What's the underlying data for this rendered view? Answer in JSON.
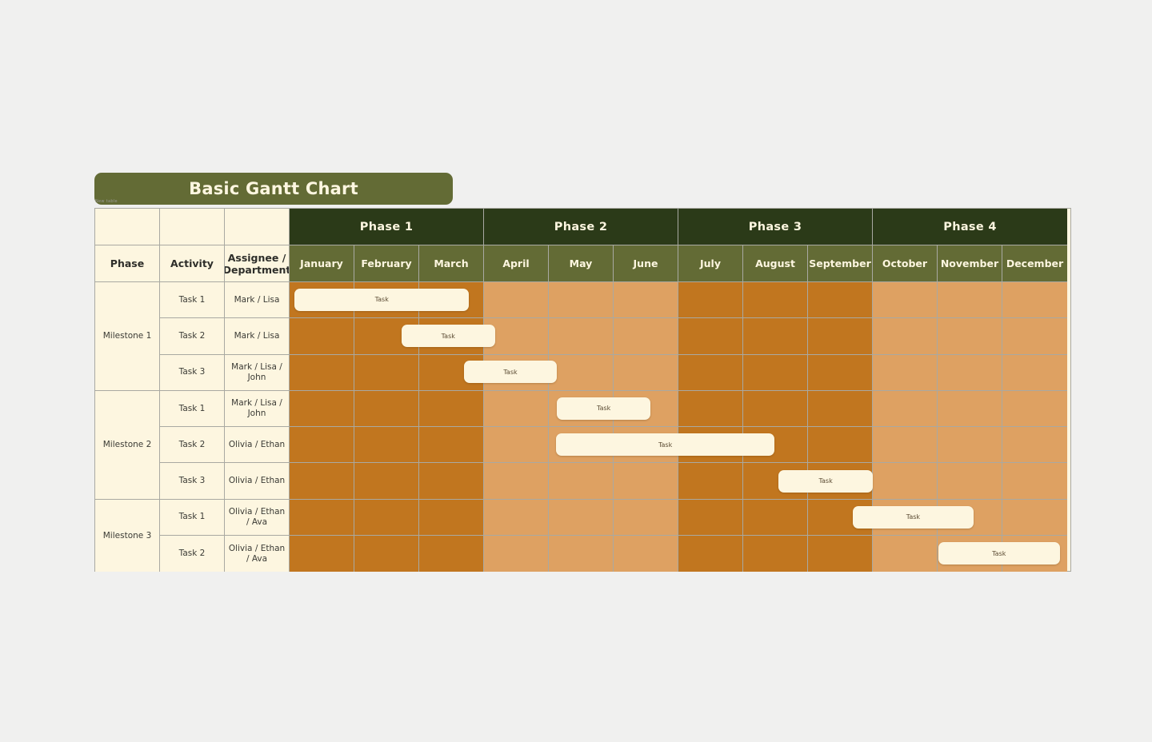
{
  "title": {
    "text": "Basic Gantt Chart"
  },
  "ghost_label": "New table",
  "colors": {
    "page_background": "#f0f0ef",
    "banner": "#636b35",
    "phase_header": "#2b3a18",
    "month_header": "#636b35",
    "cream": "#fdf6e0",
    "timeline_dark": "#c1761f",
    "timeline_light": "#dea162",
    "grid_line": "#a9a9a2"
  },
  "table": {
    "left_headers": [
      "Phase",
      "Activity",
      "Assignee / Department"
    ],
    "left_headers_display": {
      "phase": "Phase",
      "activity": "Activity",
      "assignee_line1": "Assignee /",
      "assignee_line2": "Department"
    },
    "phases": [
      {
        "label": "Phase 1",
        "months": [
          "January",
          "February",
          "March"
        ],
        "shade": "dark"
      },
      {
        "label": "Phase 2",
        "months": [
          "April",
          "May",
          "June"
        ],
        "shade": "light"
      },
      {
        "label": "Phase 3",
        "months": [
          "July",
          "August",
          "September"
        ],
        "shade": "dark"
      },
      {
        "label": "Phase 4",
        "months": [
          "October",
          "November",
          "December"
        ],
        "shade": "light"
      }
    ],
    "months": [
      "January",
      "February",
      "March",
      "April",
      "May",
      "June",
      "July",
      "August",
      "September",
      "October",
      "November",
      "December"
    ],
    "milestones": [
      {
        "label": "Milestone 1",
        "rows": [
          {
            "activity": "Task 1",
            "assignee": "Mark / Lisa"
          },
          {
            "activity": "Task 2",
            "assignee": "Mark / Lisa"
          },
          {
            "activity": "Task 3",
            "assignee": "Mark / Lisa / John"
          }
        ]
      },
      {
        "label": "Milestone 2",
        "rows": [
          {
            "activity": "Task 1",
            "assignee": "Mark / Lisa / John"
          },
          {
            "activity": "Task 2",
            "assignee": "Olivia / Ethan"
          },
          {
            "activity": "Task 3",
            "assignee": "Olivia / Ethan"
          }
        ]
      },
      {
        "label": "Milestone 3",
        "rows": [
          {
            "activity": "Task 1",
            "assignee": "Olivia / Ethan / Ava"
          },
          {
            "activity": "Task 2",
            "assignee": "Olivia / Ethan / Ava"
          }
        ]
      }
    ]
  },
  "chart_data": {
    "type": "bar",
    "title": "Basic Gantt Chart",
    "xlabel": "",
    "ylabel": "",
    "categories": [
      "Milestone 1 / Task 1",
      "Milestone 1 / Task 2",
      "Milestone 1 / Task 3",
      "Milestone 2 / Task 1",
      "Milestone 2 / Task 2",
      "Milestone 2 / Task 3",
      "Milestone 3 / Task 1",
      "Milestone 3 / Task 2"
    ],
    "x_ticks": [
      "January",
      "February",
      "March",
      "April",
      "May",
      "June",
      "July",
      "August",
      "September",
      "October",
      "November",
      "December"
    ],
    "bars": [
      {
        "label": "Task",
        "row": 0,
        "start_month": "January",
        "end_month": "March",
        "start_index": 0.09,
        "span": 2.69
      },
      {
        "label": "Task",
        "row": 1,
        "start_month": "February",
        "end_month": "April",
        "start_index": 1.74,
        "span": 1.44
      },
      {
        "label": "Task",
        "row": 2,
        "start_month": "March",
        "end_month": "April",
        "start_index": 2.7,
        "span": 1.44
      },
      {
        "label": "Task",
        "row": 3,
        "start_month": "May",
        "end_month": "June",
        "start_index": 4.14,
        "span": 1.44
      },
      {
        "label": "Task",
        "row": 4,
        "start_month": "May",
        "end_month": "August",
        "start_index": 4.12,
        "span": 3.38
      },
      {
        "label": "Task",
        "row": 5,
        "start_month": "August",
        "end_month": "September",
        "start_index": 7.56,
        "span": 1.45
      },
      {
        "label": "Task",
        "row": 6,
        "start_month": "September",
        "end_month": "October",
        "start_index": 8.7,
        "span": 1.87
      },
      {
        "label": "Task",
        "row": 7,
        "start_month": "November",
        "end_month": "December",
        "start_index": 10.02,
        "span": 1.88
      }
    ],
    "legend": [],
    "grid": true
  }
}
